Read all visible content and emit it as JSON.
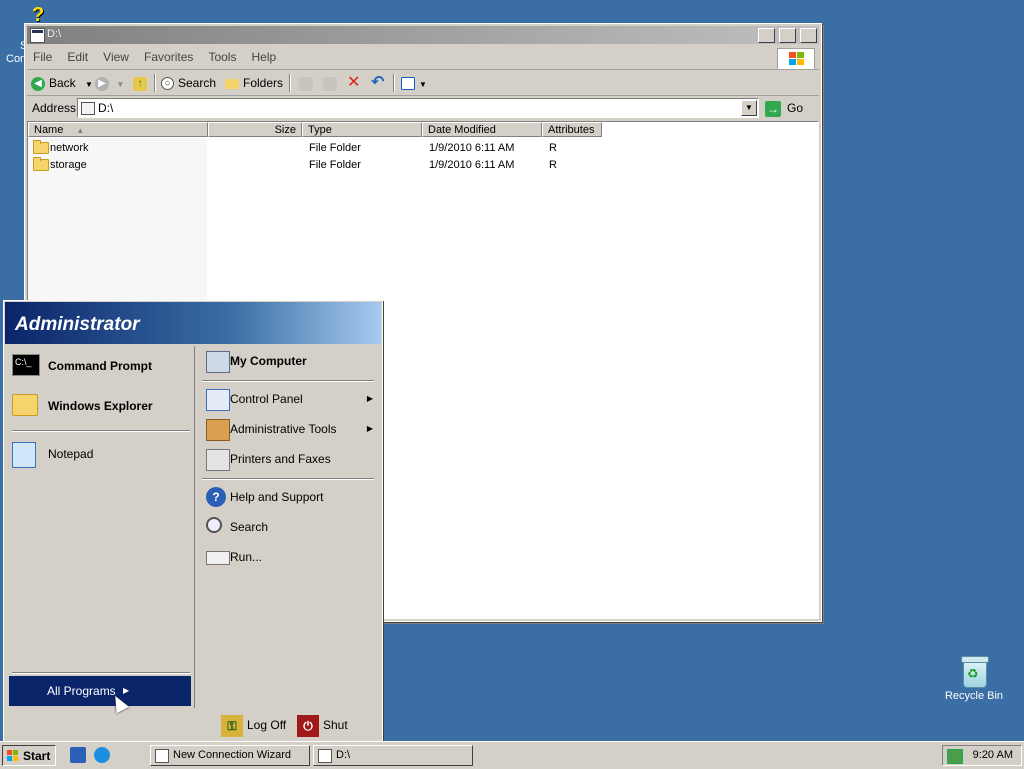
{
  "desktop": {
    "help_icon_label_line1": "S",
    "help_icon_label_line2": "Con",
    "help_icon_glyph": "?",
    "recycle_bin_label": "Recycle Bin"
  },
  "explorer": {
    "title": "D:\\",
    "window_buttons": {
      "minimize": "_",
      "maximize": "□",
      "close": "✕"
    },
    "menu": [
      "File",
      "Edit",
      "View",
      "Favorites",
      "Tools",
      "Help"
    ],
    "toolbar": {
      "back": "Back",
      "search": "Search",
      "folders": "Folders"
    },
    "address": {
      "label": "Address",
      "value": "D:\\",
      "go": "Go"
    },
    "columns": [
      "Name",
      "Size",
      "Type",
      "Date Modified",
      "Attributes"
    ],
    "files": [
      {
        "name": "network",
        "size": "",
        "type": "File Folder",
        "modified": "1/9/2010 6:11 AM",
        "attributes": "R"
      },
      {
        "name": "storage",
        "size": "",
        "type": "File Folder",
        "modified": "1/9/2010 6:11 AM",
        "attributes": "R"
      }
    ]
  },
  "start_menu": {
    "user": "Administrator",
    "left_items": [
      "Command Prompt",
      "Windows Explorer",
      "Notepad"
    ],
    "right_items": {
      "my_computer": "My Computer",
      "control_panel": "Control Panel",
      "admin_tools": "Administrative Tools",
      "printers": "Printers and Faxes",
      "help": "Help and Support",
      "search": "Search",
      "run": "Run..."
    },
    "all_programs": "All Programs",
    "log_off": "Log Off",
    "shut_down": "Shut Down"
  },
  "taskbar": {
    "start": "Start",
    "tasks": [
      "New Connection Wizard",
      "D:\\"
    ],
    "clock": "9:20 AM"
  },
  "colors": {
    "desktop": "#3a6ea5",
    "highlight": "#0a246a",
    "face": "#d4d0c8"
  }
}
